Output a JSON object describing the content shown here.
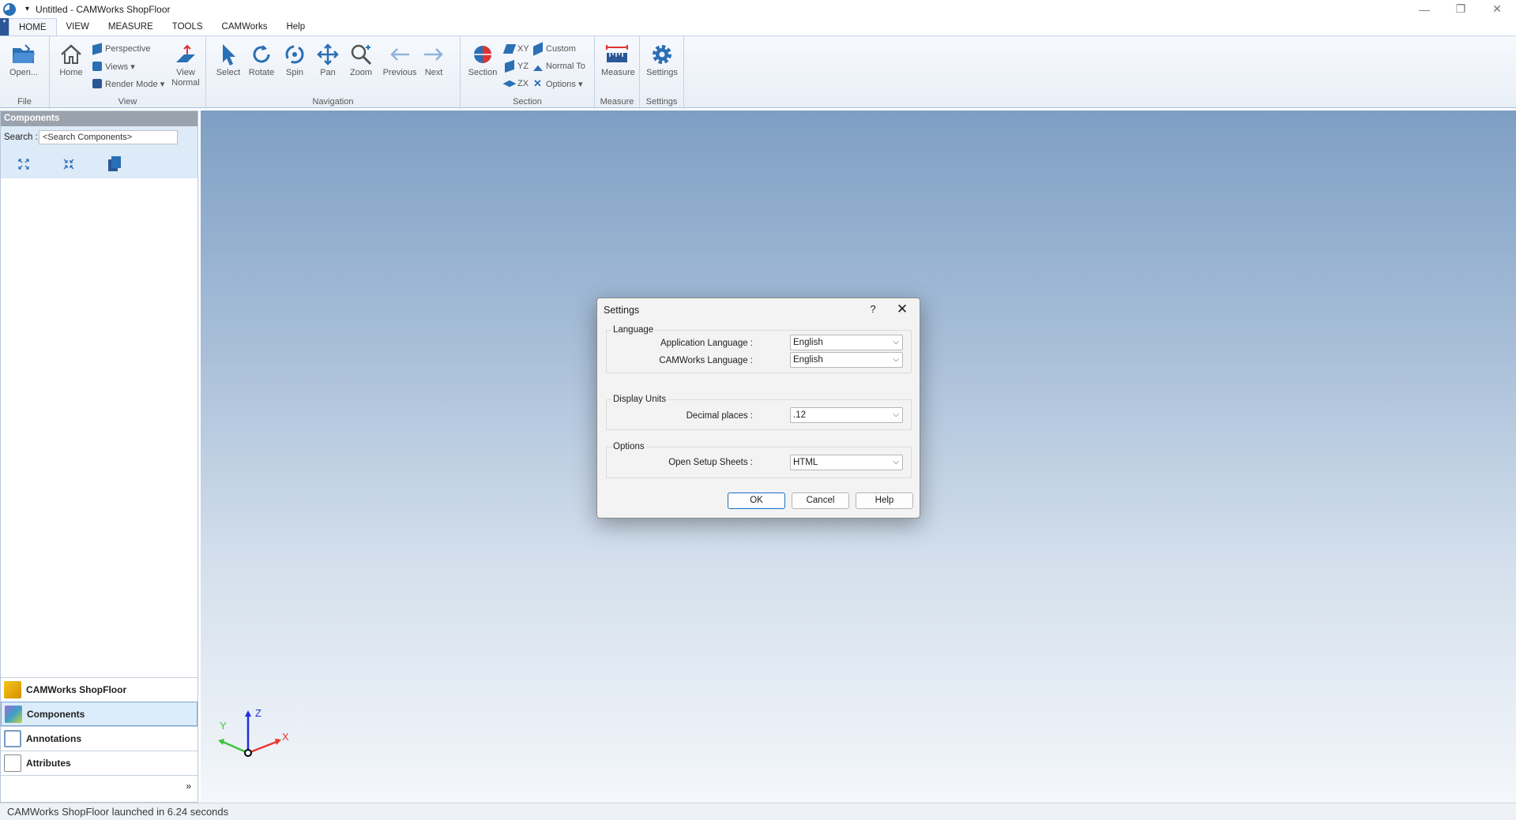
{
  "window": {
    "title": "Untitled - CAMWorks ShopFloor",
    "qat_dropdown": "▾",
    "minimize": "—",
    "restore": "❐",
    "close": "✕"
  },
  "ribbon": {
    "file_button": "▾",
    "tabs": [
      "HOME",
      "VIEW",
      "MEASURE",
      "TOOLS",
      "CAMWorks",
      "Help"
    ],
    "active_tab": "HOME",
    "groups": {
      "file": {
        "label": "File",
        "open": "Open..."
      },
      "view": {
        "label": "View",
        "home": "Home",
        "perspective": "Perspective",
        "views": "Views ▾",
        "render_mode": "Render Mode ▾",
        "view_normal_1": "View",
        "view_normal_2": "Normal"
      },
      "navigation": {
        "label": "Navigation",
        "select": "Select",
        "rotate": "Rotate",
        "spin": "Spin",
        "pan": "Pan",
        "zoom": "Zoom",
        "previous": "Previous",
        "next": "Next"
      },
      "section": {
        "label": "Section",
        "section": "Section",
        "xy": "XY",
        "yz": "YZ",
        "zx": "ZX",
        "custom": "Custom",
        "normal_to": "Normal To",
        "options": "Options ▾"
      },
      "measure": {
        "label": "Measure",
        "measure": "Measure"
      },
      "settings": {
        "label": "Settings",
        "settings": "Settings"
      }
    }
  },
  "left_panel": {
    "header": "Components",
    "search_label": "Search :",
    "search_placeholder": "<Search Components>",
    "nav": [
      {
        "label": "CAMWorks ShopFloor",
        "icon": "camworks-logo-icon"
      },
      {
        "label": "Components",
        "icon": "components-cube-icon",
        "active": true
      },
      {
        "label": "Annotations",
        "icon": "annotations-icon"
      },
      {
        "label": "Attributes",
        "icon": "attributes-page-icon"
      }
    ],
    "more": "»"
  },
  "triad": {
    "x": "X",
    "y": "Y",
    "z": "Z"
  },
  "status_bar": {
    "text": "CAMWorks ShopFloor launched in 6.24 seconds"
  },
  "dialog": {
    "title": "Settings",
    "help": "?",
    "close": "✕",
    "language": {
      "legend": "Language",
      "app_lang_label": "Application Language :",
      "app_lang_value": "English",
      "cam_lang_label": "CAMWorks Language :",
      "cam_lang_value": "English"
    },
    "display_units": {
      "legend": "Display Units",
      "decimal_label": "Decimal places :",
      "decimal_value": ".12"
    },
    "options": {
      "legend": "Options",
      "setup_label": "Open Setup Sheets :",
      "setup_value": "HTML"
    },
    "buttons": {
      "ok": "OK",
      "cancel": "Cancel",
      "help": "Help"
    }
  },
  "colors": {
    "accent": "#2b6fb5",
    "viewport_top": "#7e9fc4",
    "viewport_bottom": "#f4f7fb",
    "axis_x": "#e8372f",
    "axis_y": "#3cc43c",
    "axis_z": "#1d2fe0"
  }
}
